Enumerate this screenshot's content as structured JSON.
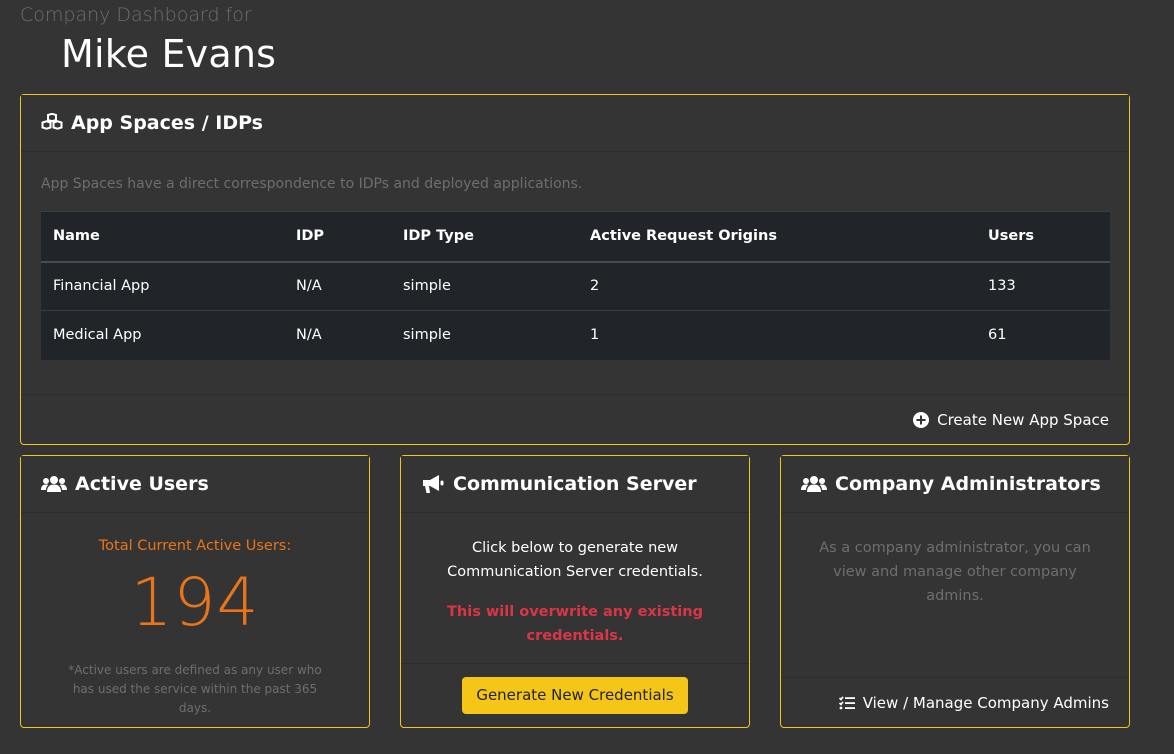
{
  "page": {
    "subtitle": "Company Dashboard for",
    "user_name": "Mike Evans"
  },
  "app_spaces": {
    "title": "App Spaces / IDPs",
    "description": "App Spaces have a direct correspondence to IDPs and deployed applications.",
    "columns": [
      "Name",
      "IDP",
      "IDP Type",
      "Active Request Origins",
      "Users"
    ],
    "rows": [
      [
        "Financial App",
        "N/A",
        "simple",
        "2",
        "133"
      ],
      [
        "Medical App",
        "N/A",
        "simple",
        "1",
        "61"
      ]
    ],
    "create_label": "Create New App Space",
    "create_icon": "plus-circle-icon"
  },
  "active_users": {
    "title": "Active Users",
    "icon": "users-icon",
    "label": "Total Current Active Users:",
    "count": "194",
    "note": "*Active users are defined as any user who has used the service within the past 365 days."
  },
  "comm_server": {
    "title": "Communication Server",
    "icon": "megaphone-icon",
    "text": "Click below to generate new Communication Server credentials.",
    "warning": "This will overwrite any existing credentials.",
    "button_label": "Generate New Credentials"
  },
  "company_admins": {
    "title": "Company Administrators",
    "icon": "users-icon",
    "text": "As a company administrator, you can view and manage other company admins.",
    "link_label": "View / Manage Company Admins",
    "link_icon": "list-check-icon"
  },
  "colors": {
    "background": "#343434",
    "accent": "#f5c518",
    "orange": "#e8751a",
    "danger": "#dc3545",
    "table_bg": "#212529"
  }
}
